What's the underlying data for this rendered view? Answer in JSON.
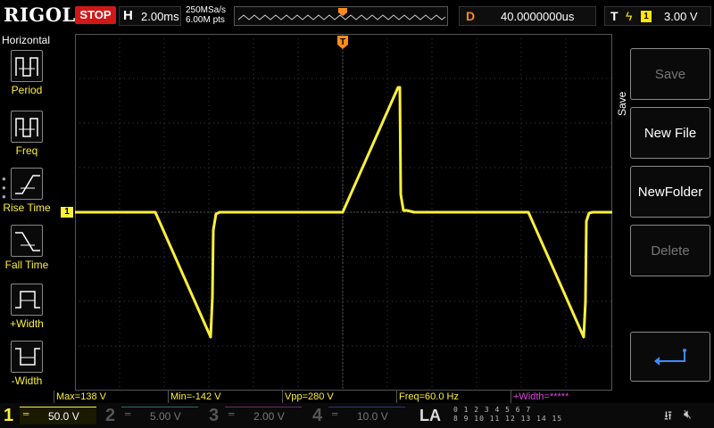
{
  "header": {
    "brand": "RIGOL",
    "run_state": "STOP",
    "timebase_label": "H",
    "timebase_value": "2.00ms",
    "sample_rate": "250MSa/s",
    "memory_depth": "6.00M pts",
    "delay_label": "D",
    "delay_value": "40.0000000us",
    "trigger_label": "T",
    "trigger_slope": "ϟ",
    "trigger_source": "1",
    "trigger_level": "3.00 V"
  },
  "left_menu": {
    "title": "Horizontal",
    "items": [
      {
        "label": "Period",
        "icon": "period-icon"
      },
      {
        "label": "Freq",
        "icon": "freq-icon"
      },
      {
        "label": "Rise Time",
        "icon": "rise-time-icon"
      },
      {
        "label": "Fall Time",
        "icon": "fall-time-icon"
      },
      {
        "label": "+Width",
        "icon": "pos-width-icon"
      },
      {
        "label": "-Width",
        "icon": "neg-width-icon"
      }
    ]
  },
  "right_menu": {
    "title": "Save",
    "buttons": [
      {
        "label": "Save",
        "enabled": false
      },
      {
        "label": "New File",
        "enabled": true
      },
      {
        "label": "NewFolder",
        "enabled": true
      },
      {
        "label": "Delete",
        "enabled": false
      }
    ],
    "back_icon": "enter-return-icon"
  },
  "measurements": {
    "max": "Max=138 V",
    "min": "Min=-142 V",
    "vpp": "Vpp=280 V",
    "freq": "Freq=60.0 Hz",
    "pwidth": "+Width=*****"
  },
  "channels": [
    {
      "num": "1",
      "coupling": "═",
      "scale": "50.0 V",
      "color": "#fdf03a",
      "active": true
    },
    {
      "num": "2",
      "coupling": "═",
      "scale": "5.00 V",
      "color": "#2ad4d4",
      "active": false
    },
    {
      "num": "3",
      "coupling": "═",
      "scale": "2.00 V",
      "color": "#e040e0",
      "active": false
    },
    {
      "num": "4",
      "coupling": "═",
      "scale": "10.0 V",
      "color": "#3a6cff",
      "active": false
    }
  ],
  "la": {
    "label": "LA",
    "row1": "0 1 2 3  4 5 6 7",
    "row2": "8 9 10 11  12 13 14 15"
  },
  "markers": {
    "ch1_ref": "1",
    "trigger_pos": "T",
    "trigger_level": "T"
  },
  "status": {
    "usb_icon": "usb-icon",
    "sound_icon": "speaker-muted-icon"
  },
  "colors": {
    "trace": "#fdf03a",
    "trigger_marker": "#ff8c1a",
    "stop": "#d01818"
  }
}
